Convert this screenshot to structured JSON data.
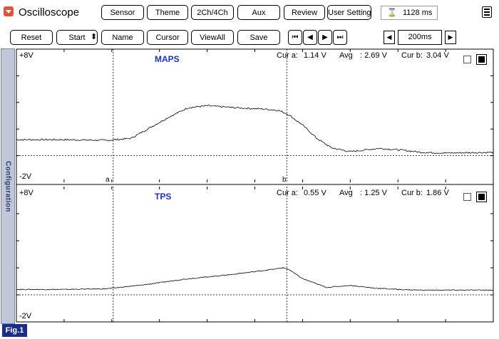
{
  "app": {
    "title": "Oscilloscope",
    "time_display": "1128 ms",
    "timer_icon": "hourglass-icon",
    "menu_icon": "hamburger-menu-icon"
  },
  "toolbar_top": [
    {
      "label": "Sensor",
      "name": "sensor-button"
    },
    {
      "label": "Theme",
      "name": "theme-button"
    },
    {
      "label": "2Ch/4Ch",
      "name": "channel-mode-button"
    },
    {
      "label": "Aux",
      "name": "aux-button"
    },
    {
      "label": "Review",
      "name": "review-button"
    },
    {
      "label": "User Setting",
      "name": "user-setting-button"
    }
  ],
  "toolbar_bottom": [
    {
      "label": "Reset",
      "name": "reset-button"
    },
    {
      "label": "Start",
      "name": "start-button"
    },
    {
      "label": "Name",
      "name": "name-button"
    },
    {
      "label": "Cursor",
      "name": "cursor-button"
    },
    {
      "label": "ViewAll",
      "name": "view-all-button"
    },
    {
      "label": "Save",
      "name": "save-button"
    }
  ],
  "start_spinner": "⬍",
  "nav_buttons": [
    {
      "glyph": "⏮",
      "name": "skip-to-start-button"
    },
    {
      "glyph": "◀",
      "name": "step-back-button"
    },
    {
      "glyph": "▶",
      "name": "step-forward-button"
    },
    {
      "glyph": "⏭",
      "name": "skip-to-end-button"
    }
  ],
  "timebase": {
    "value": "200ms",
    "decrease": "◀",
    "increase": "▶"
  },
  "sidebar_label": "Configuration",
  "figure_label": "Fig.1",
  "channels": [
    {
      "name": "MAPS",
      "ymax_label": "+8V",
      "ymin_label": "-2V",
      "cursor_a_label": "Cur a:",
      "cursor_a_value": "1.14 V",
      "avg_label": "Avg",
      "avg_value": ": 2.69 V",
      "cursor_b_label": "Cur b:",
      "cursor_b_value": "3.04 V",
      "marker_a": "a",
      "marker_b": "b"
    },
    {
      "name": "TPS",
      "ymax_label": "+8V",
      "ymin_label": "-2V",
      "cursor_a_label": "Cur a:",
      "cursor_a_value": "0.55 V",
      "avg_label": "Avg",
      "avg_value": ": 1.25 V",
      "cursor_b_label": "Cur b:",
      "cursor_b_value": "1.86 V"
    }
  ],
  "chart_data": [
    {
      "type": "line",
      "title": "MAPS",
      "xlim": [
        0,
        1
      ],
      "ylim": [
        -2,
        8
      ],
      "cursor_a_x": 0.203,
      "cursor_b_x": 0.567,
      "series": [
        {
          "name": "MAPS",
          "x": [
            0.0,
            0.1,
            0.19,
            0.24,
            0.28,
            0.32,
            0.36,
            0.4,
            0.46,
            0.52,
            0.55,
            0.57,
            0.6,
            0.63,
            0.66,
            0.7,
            0.76,
            0.8,
            0.85,
            0.9,
            1.0
          ],
          "y": [
            1.2,
            1.2,
            1.15,
            1.3,
            2.1,
            2.9,
            3.6,
            3.75,
            3.6,
            3.5,
            3.4,
            3.1,
            2.3,
            1.3,
            0.6,
            0.3,
            0.55,
            0.45,
            0.25,
            0.2,
            0.25
          ]
        }
      ]
    },
    {
      "type": "line",
      "title": "TPS",
      "xlim": [
        0,
        1
      ],
      "ylim": [
        -2,
        8
      ],
      "cursor_a_x": 0.203,
      "cursor_b_x": 0.567,
      "series": [
        {
          "name": "TPS",
          "x": [
            0.0,
            0.1,
            0.19,
            0.27,
            0.35,
            0.45,
            0.53,
            0.56,
            0.57,
            0.6,
            0.65,
            0.7,
            0.75,
            0.8,
            0.85,
            0.9,
            1.0
          ],
          "y": [
            0.4,
            0.4,
            0.45,
            0.75,
            1.15,
            1.5,
            1.85,
            2.0,
            1.9,
            1.2,
            0.55,
            0.7,
            0.5,
            0.4,
            0.35,
            0.35,
            0.35
          ]
        }
      ]
    }
  ]
}
